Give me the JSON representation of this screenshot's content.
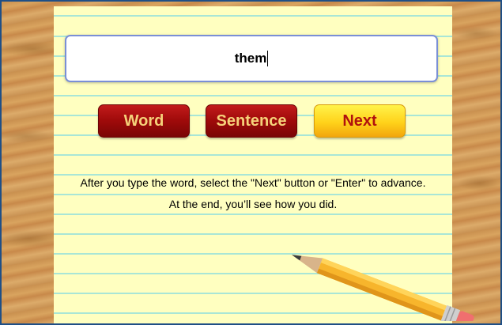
{
  "input": {
    "value": "them"
  },
  "buttons": {
    "word": "Word",
    "sentence": "Sentence",
    "next": "Next"
  },
  "instructions": {
    "line1": "After you type the word, select the \"Next\" button or \"Enter\" to advance.",
    "line2": "At the end, you’ll see how you did."
  },
  "colors": {
    "paper": "#ffffc0",
    "rule_lines": "#a9e6d6",
    "button_red": "#9e0a0a",
    "button_red_text": "#f5d27a",
    "button_yellow": "#ffd21a",
    "button_yellow_text": "#b0110e",
    "frame_border": "#1f4f86"
  },
  "decorations": {
    "pencil": "pencil-icon"
  }
}
